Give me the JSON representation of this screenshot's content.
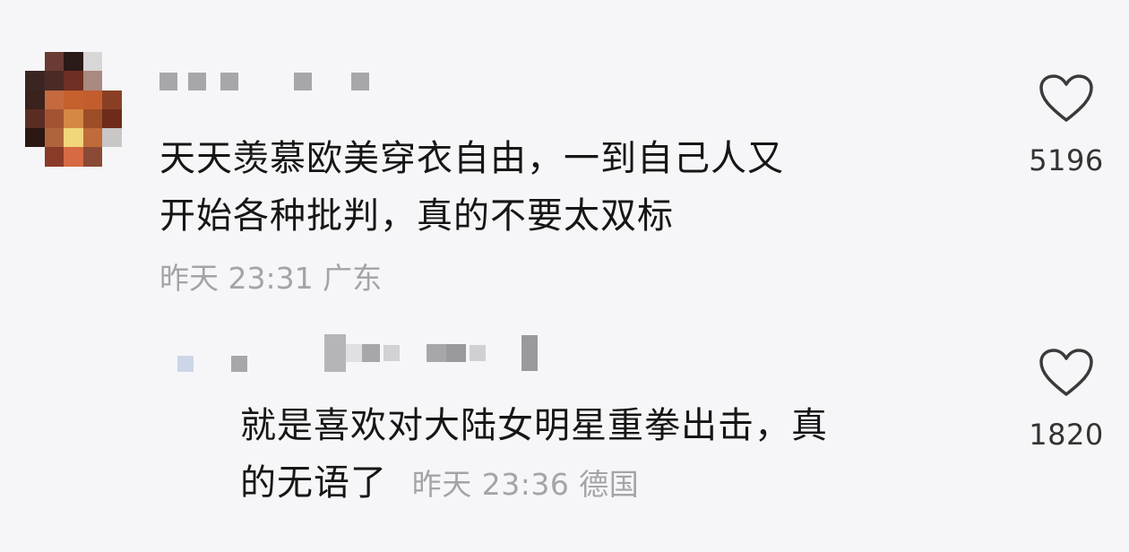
{
  "comments": [
    {
      "text_line1": "天天羡慕欧美穿衣自由，一到自己人又",
      "text_line2": "开始各种批判，真的不要太双标",
      "meta": "昨天 23:31 广东",
      "likes": "5196",
      "like_icon": "heart-outline-icon",
      "avatar_style": "pixelated"
    },
    {
      "text_line1": "就是喜欢对大陆女明星重拳出击，真",
      "text_line2": "的无语了",
      "meta": "昨天 23:36 德国",
      "likes": "1820",
      "like_icon": "heart-outline-icon"
    }
  ],
  "colors": {
    "background": "#f6f6f8",
    "text": "#161616",
    "meta": "#a4a4a8",
    "icon": "#3a3a3a"
  }
}
